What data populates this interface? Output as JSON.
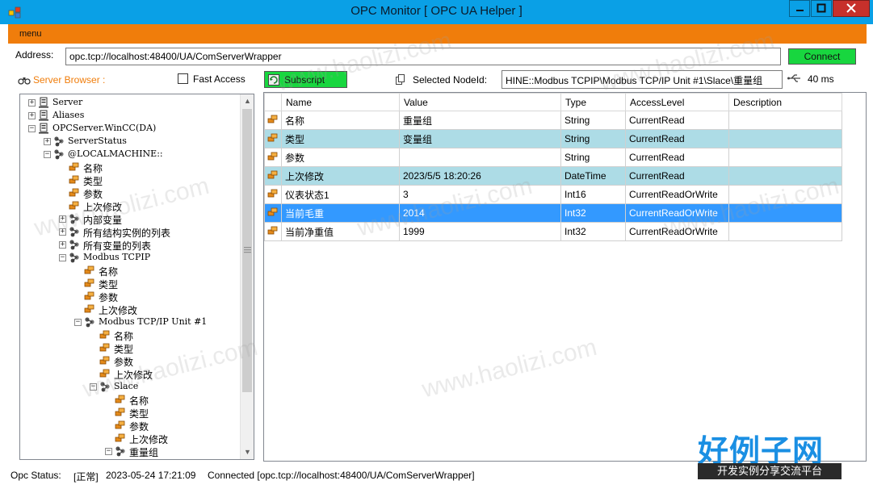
{
  "window": {
    "title": "OPC Monitor [ OPC UA Helper ]",
    "controls": [
      "minimize-icon",
      "maximize-icon",
      "close-icon"
    ],
    "accent_color": "#0aa0e6",
    "close_color": "#c7302b"
  },
  "menubar": {
    "menu_label": "menu",
    "color": "#f07d0b"
  },
  "address": {
    "label": "Address:",
    "value": "opc.tcp://localhost:48400/UA/ComServerWrapper",
    "connect_label": "Connect"
  },
  "browser": {
    "label": "Server Browser :",
    "fast_access_label": "Fast Access",
    "subscript_label": "Subscript"
  },
  "selected": {
    "label": "Selected NodeId:",
    "value": "HINE::Modbus TCPIP\\Modbus TCP/IP Unit #1\\Slace\\重量组",
    "interval": "40 ms"
  },
  "tree": [
    {
      "label": "Server",
      "icon": "server-icon",
      "exp": "+",
      "depth": 0,
      "mono": true
    },
    {
      "label": "Aliases",
      "icon": "server-icon",
      "exp": "+",
      "depth": 0,
      "mono": true
    },
    {
      "label": "OPCServer.WinCC(DA)",
      "icon": "server-icon",
      "exp": "−",
      "depth": 0,
      "mono": true
    },
    {
      "label": "ServerStatus",
      "icon": "object-icon",
      "exp": "+",
      "depth": 1,
      "mono": true
    },
    {
      "label": "@LOCALMACHINE::",
      "icon": "object-icon",
      "exp": "−",
      "depth": 1,
      "mono": true
    },
    {
      "label": "名称",
      "icon": "property-icon",
      "exp": "",
      "depth": 2
    },
    {
      "label": "类型",
      "icon": "property-icon",
      "exp": "",
      "depth": 2
    },
    {
      "label": "参数",
      "icon": "property-icon",
      "exp": "",
      "depth": 2
    },
    {
      "label": "上次修改",
      "icon": "property-icon",
      "exp": "",
      "depth": 2
    },
    {
      "label": "内部变量",
      "icon": "object-icon",
      "exp": "+",
      "depth": 2
    },
    {
      "label": "所有结构实例的列表",
      "icon": "object-icon",
      "exp": "+",
      "depth": 2
    },
    {
      "label": "所有变量的列表",
      "icon": "object-icon",
      "exp": "+",
      "depth": 2
    },
    {
      "label": "Modbus TCPIP",
      "icon": "object-icon",
      "exp": "−",
      "depth": 2,
      "mono": true
    },
    {
      "label": "名称",
      "icon": "property-icon",
      "exp": "",
      "depth": 3
    },
    {
      "label": "类型",
      "icon": "property-icon",
      "exp": "",
      "depth": 3
    },
    {
      "label": "参数",
      "icon": "property-icon",
      "exp": "",
      "depth": 3
    },
    {
      "label": "上次修改",
      "icon": "property-icon",
      "exp": "",
      "depth": 3
    },
    {
      "label": "Modbus TCP/IP Unit #1",
      "icon": "object-icon",
      "exp": "−",
      "depth": 3,
      "mono": true
    },
    {
      "label": "名称",
      "icon": "property-icon",
      "exp": "",
      "depth": 4
    },
    {
      "label": "类型",
      "icon": "property-icon",
      "exp": "",
      "depth": 4
    },
    {
      "label": "参数",
      "icon": "property-icon",
      "exp": "",
      "depth": 4
    },
    {
      "label": "上次修改",
      "icon": "property-icon",
      "exp": "",
      "depth": 4
    },
    {
      "label": "Slace",
      "icon": "object-icon",
      "exp": "−",
      "depth": 4,
      "mono": true
    },
    {
      "label": "名称",
      "icon": "property-icon",
      "exp": "",
      "depth": 5
    },
    {
      "label": "类型",
      "icon": "property-icon",
      "exp": "",
      "depth": 5
    },
    {
      "label": "参数",
      "icon": "property-icon",
      "exp": "",
      "depth": 5
    },
    {
      "label": "上次修改",
      "icon": "property-icon",
      "exp": "",
      "depth": 5
    },
    {
      "label": "重量组",
      "icon": "object-icon",
      "exp": "−",
      "depth": 5
    }
  ],
  "grid": {
    "columns": [
      "Name",
      "Value",
      "Type",
      "AccessLevel",
      "Description"
    ],
    "rows": [
      {
        "name": "名称",
        "value": "重量组",
        "type": "String",
        "access": "CurrentRead",
        "desc": "",
        "style": ""
      },
      {
        "name": "类型",
        "value": "变量组",
        "type": "String",
        "access": "CurrentRead",
        "desc": "",
        "style": "alt"
      },
      {
        "name": "参数",
        "value": "",
        "type": "String",
        "access": "CurrentRead",
        "desc": "",
        "style": ""
      },
      {
        "name": "上次修改",
        "value": "2023/5/5 18:20:26",
        "type": "DateTime",
        "access": "CurrentRead",
        "desc": "",
        "style": "alt"
      },
      {
        "name": "仪表状态1",
        "value": "3",
        "type": "Int16",
        "access": "CurrentReadOrWrite",
        "desc": "",
        "style": ""
      },
      {
        "name": "当前毛重",
        "value": "2014",
        "type": "Int32",
        "access": "CurrentReadOrWrite",
        "desc": "",
        "style": "sel"
      },
      {
        "name": "当前净重值",
        "value": "1999",
        "type": "Int32",
        "access": "CurrentReadOrWrite",
        "desc": "",
        "style": ""
      }
    ]
  },
  "status": {
    "label": "Opc Status:",
    "state": "[正常]",
    "time": "2023-05-24 17:21:09",
    "message": "Connected [opc.tcp://localhost:48400/UA/ComServerWrapper]"
  },
  "overlay": {
    "watermark": "www.haolizi.com",
    "brand_big": "好例子网",
    "brand_small": "开发实例分享交流平台"
  }
}
